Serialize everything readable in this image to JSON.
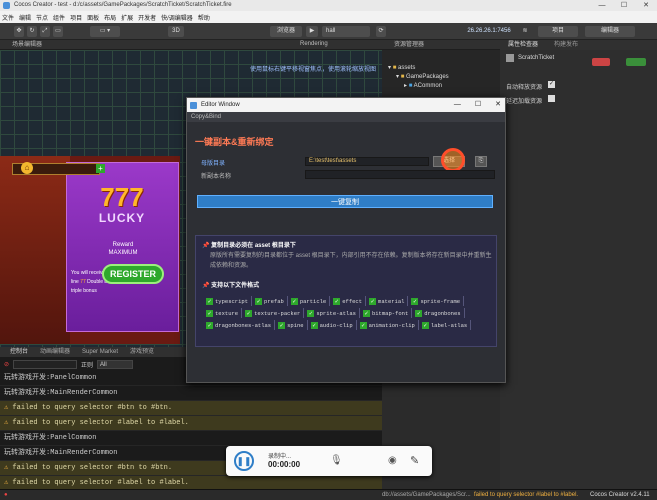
{
  "window": {
    "title": "Cocos Creator - test - d:/c/assets/GamePackages/ScratchTicket/ScratchTicket.fire",
    "controls": [
      "—",
      "☐",
      "✕"
    ]
  },
  "menu": [
    "文件",
    "编辑",
    "节点",
    "组件",
    "项目",
    "面板",
    "布局",
    "扩展",
    "开发者",
    "快/调编辑器",
    "帮助"
  ],
  "toolbar": {
    "browser_label": "浏览器",
    "scene_select": "hall",
    "ip": "26.26.26.1:7456",
    "project_btn": "项目",
    "editor_btn": "编辑器",
    "mode_3d": "3D"
  },
  "scene_panel": {
    "tab": "场景编辑器",
    "rendering": "Rendering",
    "hint": "使用鼠标右键平移视窗焦点，使用滚轮缩放视图"
  },
  "game": {
    "lucky_number": "777",
    "lucky_word": "LUCKY",
    "reward": "Reward",
    "maximum": "MAXIMUM",
    "bonus_text_1": "You will receive the bonus for each",
    "bonus_text_2": "line",
    "bonus_text_3": "Double bonus",
    "bonus_text_4": "triple bonus",
    "register": "REGISTER"
  },
  "assets_panel": {
    "tab": "资源管理器",
    "tree": [
      "assets",
      "GamePackages",
      "ACommon"
    ]
  },
  "inspector": {
    "tab_props": "属性检查器",
    "tab_build": "构建发布",
    "node_name": "ScratchTicket",
    "auto_release": "自动释放资源",
    "delay_load": "延迟加载资源"
  },
  "editor_window": {
    "title": "Editor Window",
    "subtitle": "Copy&Bind",
    "heading": "一键副本&重新绑定",
    "source_label": "母版目录",
    "source_value": "E:\\test\\test\\assets",
    "pick_btn": "选择",
    "new_name_label": "新副本名称",
    "new_name_value": "",
    "copy_btn": "一键复制",
    "note1_title": "复制目录必须在 asset 根目录下",
    "note1_body": "原版所有需要复制的目录都位于 asset 根目录下，内部引用不存在依赖。复制版本将存在新目录中并重新生成依赖和资源。",
    "note2_title": "支持以下文件格式",
    "formats": [
      "typescript",
      "prefab",
      "particle",
      "effect",
      "material",
      "sprite-frame",
      "texture",
      "texture-packer",
      "sprite-atlas",
      "bitmap-font",
      "dragonbones",
      "dragonbones-atlas",
      "spine",
      "audio-clip",
      "animation-clip",
      "label-atlas"
    ]
  },
  "console": {
    "tabs": [
      "控制台",
      "动画编辑器",
      "Super Market",
      "游戏预览"
    ],
    "filter_placeholder": "正则",
    "level": "All",
    "lines": [
      {
        "text": "玩转游戏开发:PanelCommon",
        "warn": false
      },
      {
        "text": "玩转游戏开发:MainRenderCommon",
        "warn": false
      },
      {
        "text": "failed to query selector #btn to #btn.",
        "warn": true
      },
      {
        "text": "failed to query selector #label to #label.",
        "warn": true
      },
      {
        "text": "玩转游戏开发:PanelCommon",
        "warn": false
      },
      {
        "text": "玩转游戏开发:MainRenderCommon",
        "warn": false
      },
      {
        "text": "failed to query selector #btn to #btn.",
        "warn": true
      },
      {
        "text": "failed to query selector #label to #label.",
        "warn": true
      }
    ]
  },
  "recorder": {
    "status": "录制中...",
    "time": "00:00:00"
  },
  "statusbar": {
    "path": "db://assets/GamePackages/Scr...",
    "error": "failed to query selector #label to #label.",
    "version": "Cocos Creator v2.4.11"
  }
}
